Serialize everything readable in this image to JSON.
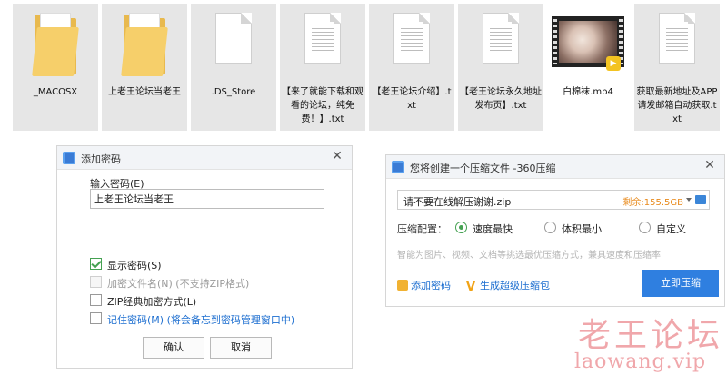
{
  "files": [
    {
      "name": "_MACOSX",
      "icon": "folder-icon"
    },
    {
      "name": "上老王论坛当老王",
      "icon": "folder-icon"
    },
    {
      "name": ".DS_Store",
      "icon": "blank-file-icon"
    },
    {
      "name": "【来了就能下载和观看的论坛，纯免费！】.txt",
      "icon": "text-file-icon"
    },
    {
      "name": "【老王论坛介绍】.txt",
      "icon": "text-file-icon"
    },
    {
      "name": "【老王论坛永久地址发布页】.txt",
      "icon": "text-file-icon"
    },
    {
      "name": "白棉袜.mp4",
      "icon": "video-file-icon"
    },
    {
      "name": "获取最新地址及APP请发邮箱自动获取.txt",
      "icon": "text-file-icon"
    }
  ],
  "password_dialog": {
    "title": "添加密码",
    "input_label": "输入密码(E)",
    "password_value": "上老王论坛当老王",
    "options": [
      {
        "label": "显示密码(S)",
        "checked": true,
        "enabled": true
      },
      {
        "label": "加密文件名(N) (不支持ZIP格式)",
        "checked": false,
        "enabled": false
      },
      {
        "label": "ZIP经典加密方式(L)",
        "checked": false,
        "enabled": true
      },
      {
        "label": "记住密码(M) (将会备忘到密码管理窗口中)",
        "checked": false,
        "enabled": true
      }
    ],
    "ok_label": "确认",
    "cancel_label": "取消"
  },
  "compress_dialog": {
    "title": "您将创建一个压缩文件 -360压缩",
    "filename": "请不要在线解压谢谢.zip",
    "remaining": "剩余:155.5GB",
    "config_label": "压缩配置：",
    "modes": [
      {
        "label": "速度最快",
        "selected": true
      },
      {
        "label": "体积最小",
        "selected": false
      },
      {
        "label": "自定义",
        "selected": false
      }
    ],
    "hint": "智能为图片、视频、文档等挑选最优压缩方式，兼具速度和压缩率",
    "add_password_link": "添加密码",
    "super_zip_link": "生成超级压缩包",
    "compress_button": "立即压缩"
  },
  "watermark": {
    "cn": "老王论坛",
    "url": "laowang.vip"
  },
  "colors": {
    "accent": "#2f7fe0",
    "check": "#45a152",
    "remaining": "#e8891a",
    "watermark": "#f0a7ab"
  }
}
